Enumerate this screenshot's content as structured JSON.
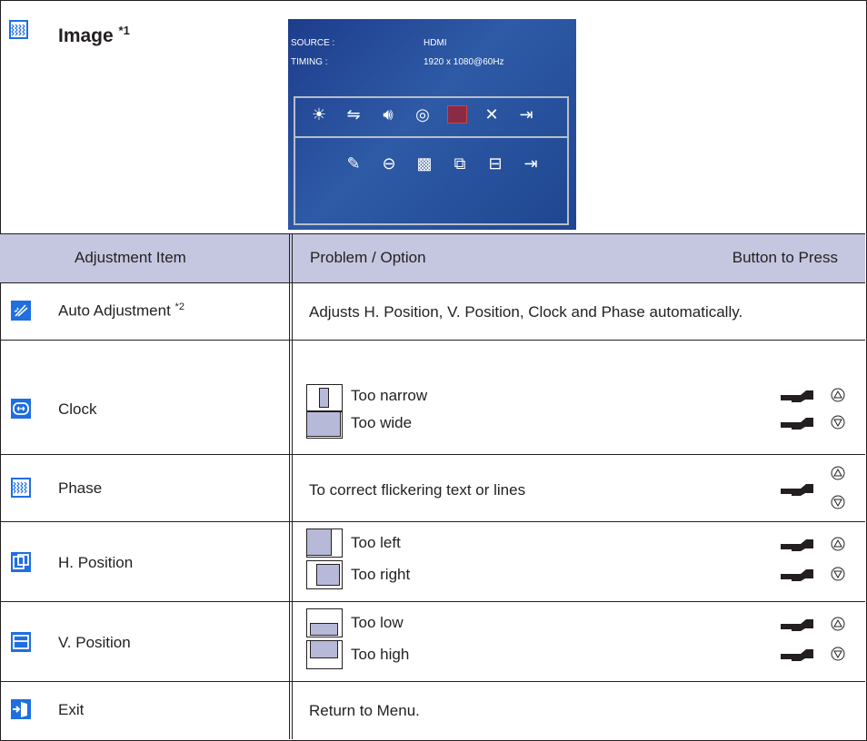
{
  "header": {
    "title": "Image",
    "title_note": "*1",
    "osd": {
      "source_label": "SOURCE :",
      "source_value": "HDMI",
      "timing_label": "TIMING :",
      "timing_value": "1920 x 1080@60Hz"
    }
  },
  "table": {
    "col_item": "Adjustment Item",
    "col_problem": "Problem / Option",
    "col_button": "Button to Press"
  },
  "rows": [
    {
      "name": "Auto Adjustment",
      "note": "*2",
      "icon": "auto-adjust-icon",
      "desc": "Adjusts H. Position, V. Position, Clock and Phase automatically."
    },
    {
      "name": "Clock",
      "icon": "clock-icon",
      "options": [
        "Too narrow",
        "Too wide"
      ],
      "buttons": [
        "up",
        "down"
      ]
    },
    {
      "name": "Phase",
      "icon": "phase-icon",
      "desc": "To correct flickering text or lines",
      "buttons": [
        "up",
        "down"
      ]
    },
    {
      "name": "H. Position",
      "icon": "h-position-icon",
      "options": [
        "Too left",
        "Too right"
      ],
      "buttons": [
        "up",
        "down"
      ]
    },
    {
      "name": "V. Position",
      "icon": "v-position-icon",
      "options": [
        "Too low",
        "Too high"
      ],
      "buttons": [
        "up",
        "down"
      ]
    },
    {
      "name": "Exit",
      "icon": "exit-icon",
      "desc": "Return to Menu."
    }
  ],
  "colors": {
    "header_bg": "#c5c7e1",
    "icon_blue": "#1f6fe0",
    "osd_blue": "#2a52a0",
    "swatch_fill": "#b7b9d9"
  }
}
